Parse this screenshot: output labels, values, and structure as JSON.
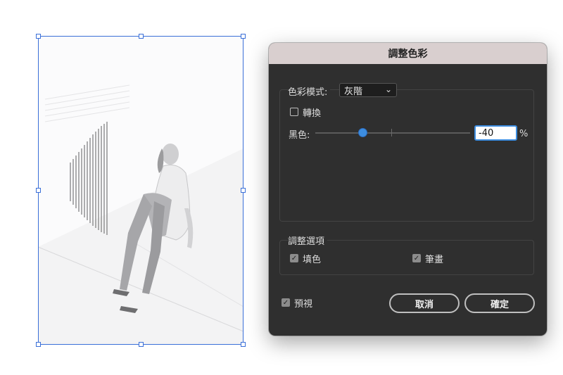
{
  "dialog": {
    "title": "調整色彩",
    "color_mode_label": "色彩模式:",
    "color_mode_value": "灰階",
    "convert_label": "轉換",
    "convert_checked": false,
    "black_label": "黑色:",
    "black_value": "-40",
    "black_percent": -40,
    "percent_unit": "%",
    "adjust_options_label": "調整選項",
    "fill_label": "填色",
    "fill_checked": true,
    "stroke_label": "筆畫",
    "stroke_checked": true,
    "preview_label": "預視",
    "preview_checked": true,
    "cancel_label": "取消",
    "ok_label": "確定"
  },
  "colors": {
    "dialog_bg": "#2f2f2f",
    "titlebar_bg": "#d9cfcf",
    "accent_blue": "#3d8de0",
    "selection_blue": "#3a6fd8"
  }
}
